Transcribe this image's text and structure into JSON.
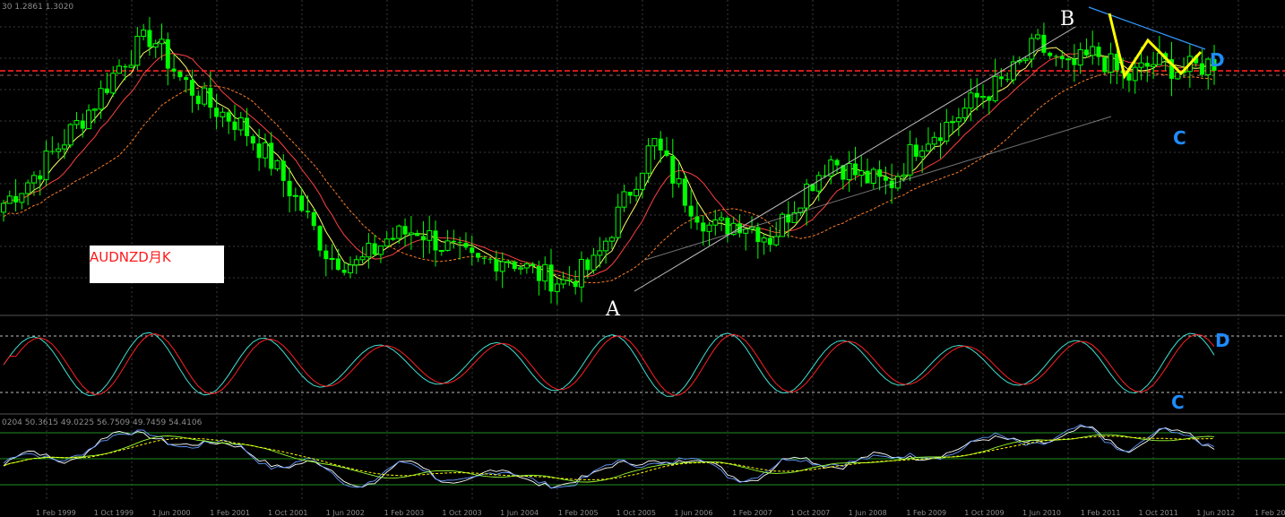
{
  "chart_data": {
    "type": "candlestick",
    "title": "AUDNZD月K",
    "indicator_header_top": "30 1.2861 1.3020",
    "indicator_header_bottom": "0204 50.3615 49.0225 56.7509 49.7459 54.4106",
    "x_tick_labels": [
      "1 Feb 1999",
      "1 Oct 1999",
      "1 Jun 2000",
      "1 Feb 2001",
      "1 Oct 2001",
      "1 Jun 2002",
      "1 Feb 2003",
      "1 Oct 2003",
      "1 Jun 2004",
      "1 Feb 2005",
      "1 Oct 2005",
      "1 Jun 2006",
      "1 Feb 2007",
      "1 Oct 2007",
      "1 Jun 2008",
      "1 Feb 2009",
      "1 Oct 2009",
      "1 Jun 2010",
      "1 Feb 2011",
      "1 Oct 2011",
      "1 Jun 2012",
      "1 Feb 2013"
    ],
    "wave_points": {
      "A": "A",
      "B": "B",
      "C_price": "C",
      "D_price": "D",
      "C_osc": "C",
      "D_osc": "D"
    },
    "price_path": [
      1.13,
      1.16,
      1.2,
      1.24,
      1.29,
      1.32,
      1.27,
      1.24,
      1.22,
      1.18,
      1.13,
      1.07,
      1.06,
      1.09,
      1.1,
      1.08,
      1.06,
      1.07,
      1.05,
      1.04,
      1.06,
      1.13,
      1.2,
      1.14,
      1.1,
      1.11,
      1.09,
      1.14,
      1.18,
      1.16,
      1.15,
      1.2,
      1.22,
      1.25,
      1.27,
      1.31,
      1.28,
      1.3,
      1.27,
      1.29,
      1.28,
      1.29
    ],
    "levels": {
      "resistance_upper": 1.28,
      "resistance_lower": 1.275,
      "line_color": "#ff2020"
    },
    "colors": {
      "background": "#000000",
      "bull_candle": "#00ff00",
      "bear_candle": "#00ff00",
      "ma_fast": "#ffff66",
      "ma_mid": "#ff4040",
      "ma_slow": "#ff7f27",
      "channel": "#c0c0c0",
      "wedge_line": "#3399ff",
      "pattern": "#ffff00",
      "stoch_main": "#40e0d0",
      "stoch_signal": "#ff2020",
      "rsi_lines": [
        "#ffffff",
        "#6699ff",
        "#99ff33",
        "#ffff00"
      ]
    }
  }
}
